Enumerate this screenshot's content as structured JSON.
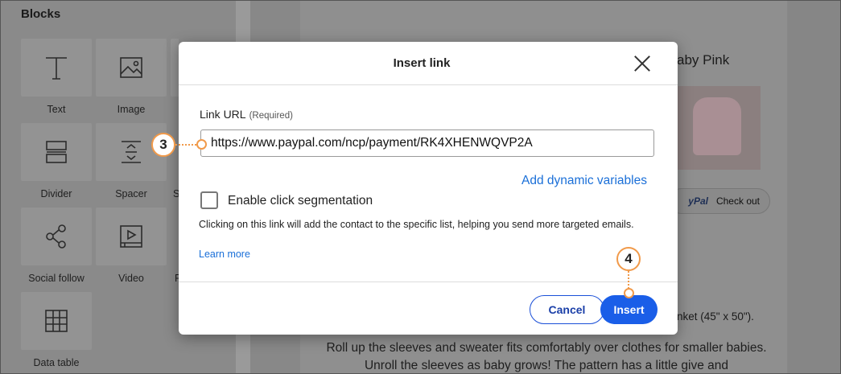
{
  "sidebar": {
    "title": "Blocks",
    "blocks": [
      {
        "label": "Text",
        "icon": "text-icon"
      },
      {
        "label": "Image",
        "icon": "image-icon"
      },
      {
        "label": "Divider",
        "icon": "divider-icon"
      },
      {
        "label": "Spacer",
        "icon": "spacer-icon"
      },
      {
        "label": "Social follow",
        "icon": "share-icon"
      },
      {
        "label": "Video",
        "icon": "video-icon"
      },
      {
        "label": "Data table",
        "icon": "table-icon"
      }
    ],
    "partial_labels": [
      "S",
      "P"
    ]
  },
  "email": {
    "title_fragment": "aby Pink",
    "paypal_label": "PayPal",
    "paypal_fragment": "yPal",
    "checkout_label": "Check out",
    "body_fragment": "nket (45\" x 50\").",
    "body_text": "Roll up the sleeves and sweater fits comfortably over clothes for smaller babies. Unroll the sleeves as baby grows! The pattern has a little give and"
  },
  "modal": {
    "title": "Insert link",
    "url_label": "Link URL",
    "url_required": "(Required)",
    "url_value": "https://www.paypal.com/ncp/payment/RK4XHENWQVP2A",
    "dynamic_variables": "Add dynamic variables",
    "segmentation_label": "Enable click segmentation",
    "segmentation_checked": false,
    "help_text": "Clicking on this link will add the contact to the specific list, helping you send more targeted emails.",
    "learn_more": "Learn more",
    "cancel_label": "Cancel",
    "insert_label": "Insert"
  },
  "callouts": {
    "step_url": "3",
    "step_insert": "4"
  },
  "colors": {
    "accent": "#1a5ee8",
    "link": "#1a6fd8",
    "callout": "#f19a4a"
  }
}
